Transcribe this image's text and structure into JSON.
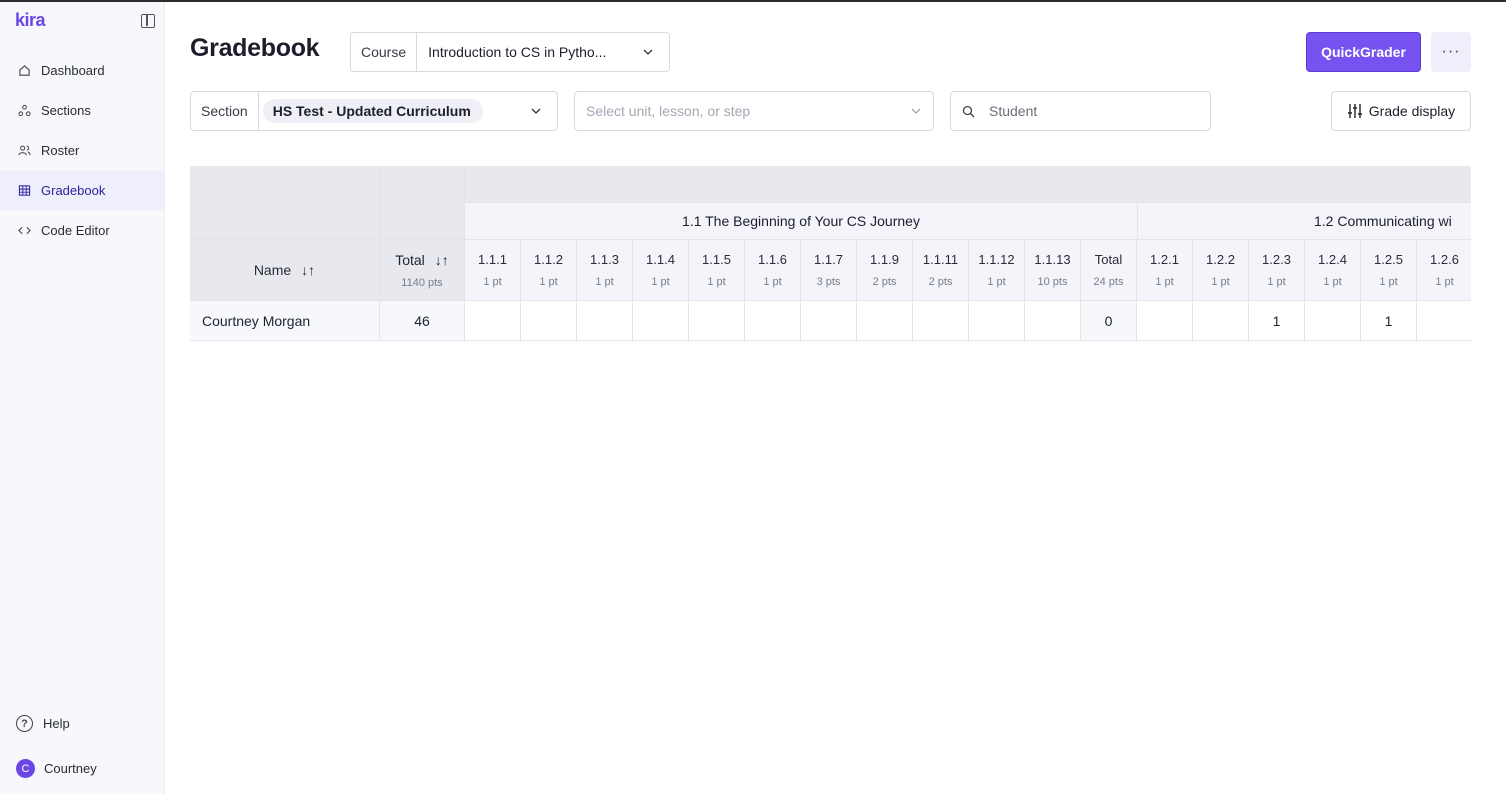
{
  "sidebar": {
    "logo": "kira",
    "items": [
      {
        "label": "Dashboard",
        "icon": "home-icon"
      },
      {
        "label": "Sections",
        "icon": "sections-icon"
      },
      {
        "label": "Roster",
        "icon": "users-icon"
      },
      {
        "label": "Gradebook",
        "icon": "grid-icon",
        "active": true
      },
      {
        "label": "Code Editor",
        "icon": "code-icon"
      }
    ],
    "help_label": "Help",
    "user_initial": "C",
    "user_name": "Courtney"
  },
  "header": {
    "title": "Gradebook",
    "course_label": "Course",
    "course_value": "Introduction to CS in Pytho...",
    "quickgrader_label": "QuickGrader",
    "more_label": "···"
  },
  "filters": {
    "section_label": "Section",
    "section_value": "HS Test - Updated Curriculum",
    "unit_placeholder": "Select unit, lesson, or step",
    "student_placeholder": "Student",
    "grade_display_label": "Grade display"
  },
  "table": {
    "name_header": "Name",
    "total_header": "Total",
    "total_pts": "1140 pts",
    "groups": [
      {
        "title": "1.1 The Beginning of Your CS Journey"
      },
      {
        "title": "1.2 Communicating wi"
      }
    ],
    "columns": [
      {
        "label": "1.1.1",
        "pts": "1 pt"
      },
      {
        "label": "1.1.2",
        "pts": "1 pt"
      },
      {
        "label": "1.1.3",
        "pts": "1 pt"
      },
      {
        "label": "1.1.4",
        "pts": "1 pt"
      },
      {
        "label": "1.1.5",
        "pts": "1 pt"
      },
      {
        "label": "1.1.6",
        "pts": "1 pt"
      },
      {
        "label": "1.1.7",
        "pts": "3 pts"
      },
      {
        "label": "1.1.9",
        "pts": "2 pts"
      },
      {
        "label": "1.1.11",
        "pts": "2 pts"
      },
      {
        "label": "1.1.12",
        "pts": "1 pt"
      },
      {
        "label": "1.1.13",
        "pts": "10 pts"
      },
      {
        "label": "Total",
        "pts": "24 pts"
      },
      {
        "label": "1.2.1",
        "pts": "1 pt"
      },
      {
        "label": "1.2.2",
        "pts": "1 pt"
      },
      {
        "label": "1.2.3",
        "pts": "1 pt"
      },
      {
        "label": "1.2.4",
        "pts": "1 pt"
      },
      {
        "label": "1.2.5",
        "pts": "1 pt"
      },
      {
        "label": "1.2.6",
        "pts": "1 pt"
      }
    ],
    "rows": [
      {
        "name": "Courtney Morgan",
        "total": "46",
        "scores": [
          "",
          "",
          "",
          "",
          "",
          "",
          "",
          "",
          "",
          "",
          "",
          "0",
          "",
          "",
          "1",
          "",
          "1",
          ""
        ]
      }
    ]
  }
}
